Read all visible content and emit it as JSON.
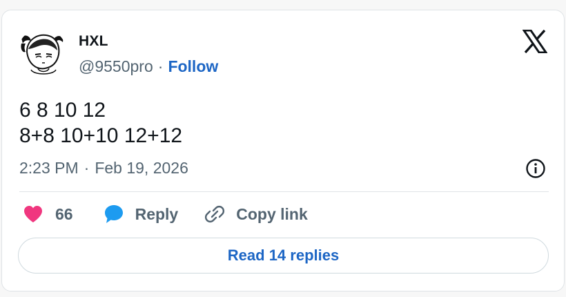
{
  "author": {
    "name": "HXL",
    "handle": "@9550pro",
    "separator": "·",
    "follow_label": "Follow"
  },
  "tweet": {
    "lines": [
      "6 8 10 12",
      "8+8 10+10 12+12"
    ],
    "time": "2:23 PM",
    "separator": "·",
    "date": "Feb 19, 2026"
  },
  "actions": {
    "like_count": "66",
    "reply_label": "Reply",
    "copy_link_label": "Copy link"
  },
  "read_replies_label": "Read 14 replies",
  "icons": {
    "logo": "x-logo-icon",
    "info": "info-icon",
    "like": "heart-icon",
    "reply": "speech-bubble-icon",
    "copy": "link-icon"
  },
  "colors": {
    "accent": "#1d66c5",
    "heart": "#f0377f",
    "reply_bubble": "#1d9bf0",
    "muted_text": "#536471"
  }
}
